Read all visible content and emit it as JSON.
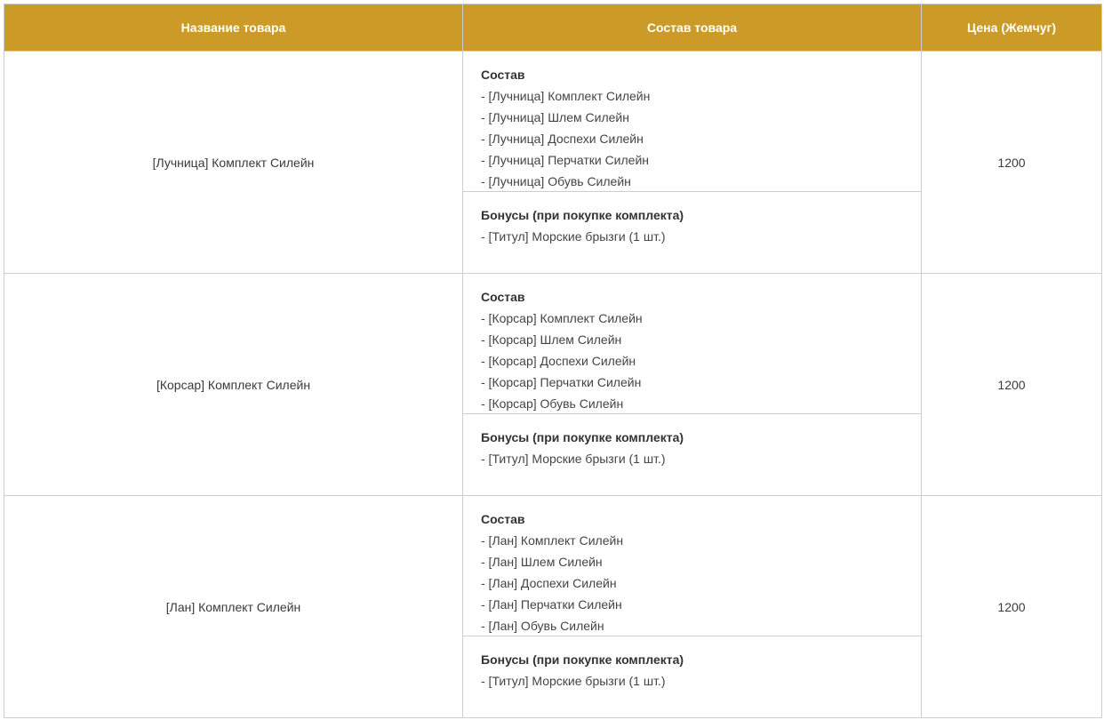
{
  "table": {
    "headers": {
      "name": "Название товара",
      "composition": "Состав товара",
      "price": "Цена (Жемчуг)"
    },
    "rows": [
      {
        "name": "[Лучница] Комплект Силейн",
        "contents_heading": "Состав",
        "contents": [
          "- [Лучница] Комплект Силейн",
          "- [Лучница] Шлем Силейн",
          "- [Лучница] Доспехи Силейн",
          "- [Лучница] Перчатки Силейн",
          "- [Лучница] Обувь Силейн"
        ],
        "bonus_heading": "Бонусы (при покупке комплекта)",
        "bonuses": [
          "- [Титул] Морские брызги (1 шт.)"
        ],
        "price": "1200"
      },
      {
        "name": "[Корсар] Комплект Силейн",
        "contents_heading": "Состав",
        "contents": [
          "- [Корсар] Комплект Силейн",
          "- [Корсар] Шлем Силейн",
          "- [Корсар] Доспехи Силейн",
          "- [Корсар] Перчатки Силейн",
          "- [Корсар] Обувь Силейн"
        ],
        "bonus_heading": "Бонусы (при покупке комплекта)",
        "bonuses": [
          "- [Титул] Морские брызги (1 шт.)"
        ],
        "price": "1200"
      },
      {
        "name": "[Лан] Комплект Силейн",
        "contents_heading": "Состав",
        "contents": [
          "- [Лан] Комплект Силейн",
          "- [Лан] Шлем Силейн",
          "- [Лан] Доспехи Силейн",
          "- [Лан] Перчатки Силейн",
          "- [Лан] Обувь Силейн"
        ],
        "bonus_heading": "Бонусы (при покупке комплекта)",
        "bonuses": [
          "- [Титул] Морские брызги (1 шт.)"
        ],
        "price": "1200"
      }
    ]
  },
  "colors": {
    "header_bg": "#cc9b27",
    "header_text": "#ffffff",
    "border": "#cdcdcd"
  }
}
